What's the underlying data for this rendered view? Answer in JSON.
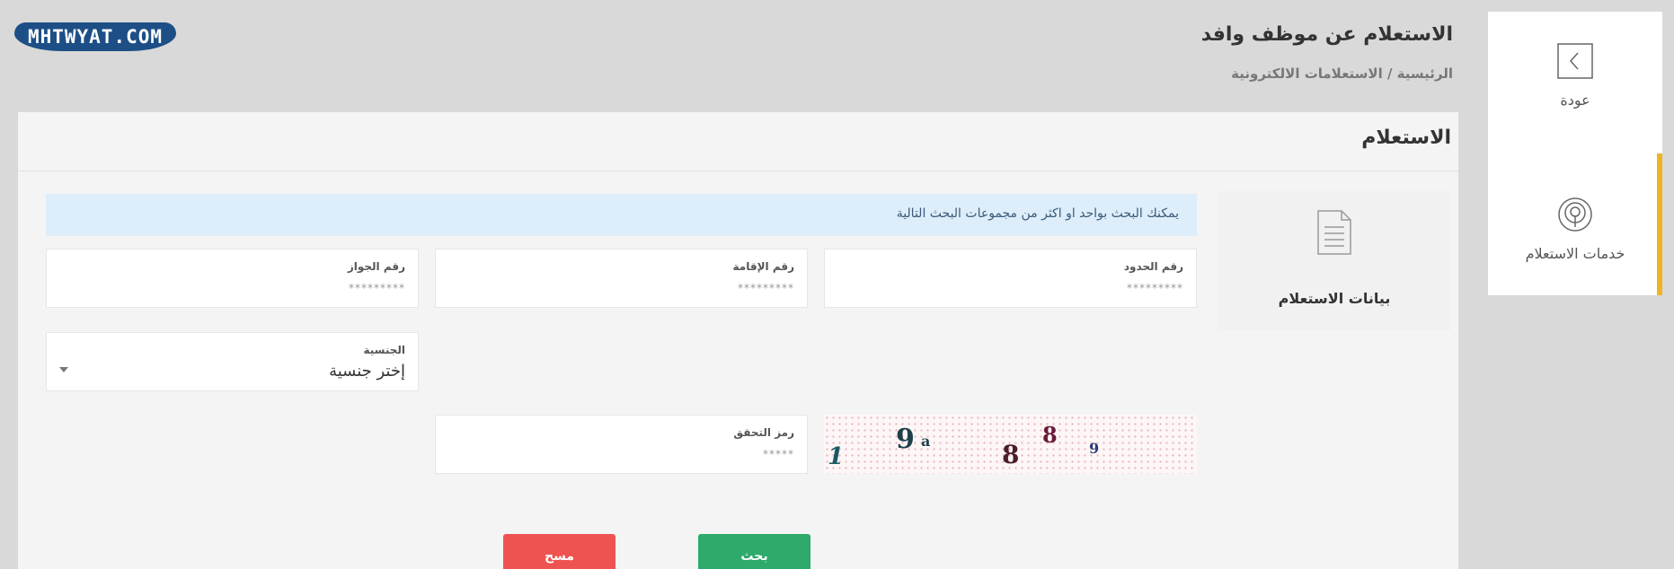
{
  "watermark": {
    "text": "MHTWYAT.COM"
  },
  "header": {
    "title": "الاستعلام عن موظف وافد",
    "breadcrumb": "الرئيسية / الاستعلامات الالكترونية"
  },
  "sidenav": {
    "items": [
      {
        "label": "عودة",
        "icon": "chevron-left-icon",
        "active": false
      },
      {
        "label": "خدمات الاستعلام",
        "icon": "broadcast-icon",
        "active": true
      }
    ],
    "accent_color": "#f0b323"
  },
  "card": {
    "title": "الاستعلام",
    "side_panel_label": "بيانات الاستعلام",
    "info_text": "يمكنك البحث بواحد او اكثر من مجموعات البحث التالية",
    "fields": {
      "border_number": {
        "label": "رقم الحدود",
        "placeholder": "*********"
      },
      "iqama_number": {
        "label": "رقم الإقامة",
        "placeholder": "*********"
      },
      "passport_number": {
        "label": "رقم الجواز",
        "placeholder": "*********"
      },
      "nationality": {
        "label": "الجنسية",
        "value": "إختر جنسية"
      },
      "captcha_code": {
        "label": "رمز التحقق",
        "placeholder": "*****"
      }
    },
    "captcha_chars": [
      "1",
      "9",
      "a",
      "8",
      "8",
      "9"
    ],
    "buttons": {
      "search": "بحث",
      "clear": "مسح"
    }
  },
  "colors": {
    "search_button": "#2eaa6b",
    "clear_button": "#ef5350",
    "info_bg": "#ddedfa"
  }
}
